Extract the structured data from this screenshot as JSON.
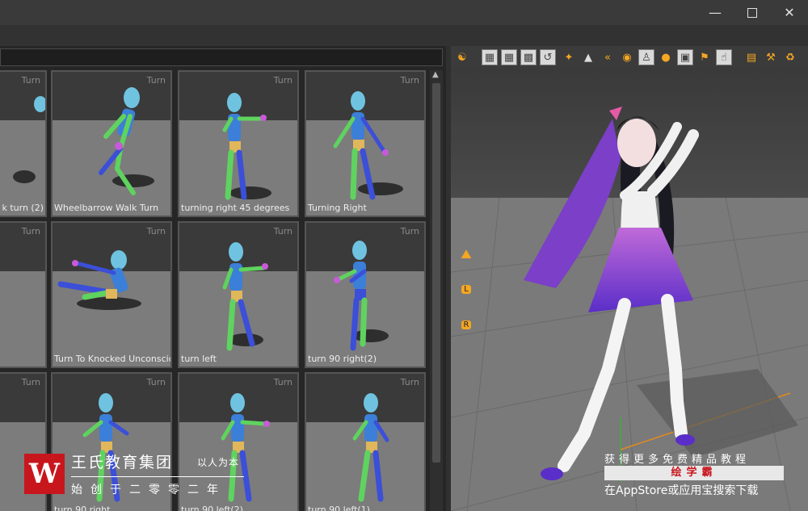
{
  "window": {
    "minimize_icon": "minimize-icon",
    "maximize_icon": "maximize-icon",
    "close_icon": "close-icon"
  },
  "library": {
    "cells": [
      {
        "badge": "Turn",
        "label": "k turn (2)"
      },
      {
        "badge": "Turn",
        "label": "Wheelbarrow Walk Turn"
      },
      {
        "badge": "Turn",
        "label": "turning right 45 degrees"
      },
      {
        "badge": "Turn",
        "label": "Turning Right"
      },
      {
        "badge": "Turn",
        "label": ""
      },
      {
        "badge": "Turn",
        "label": "Turn To Knocked Unconscious"
      },
      {
        "badge": "Turn",
        "label": "turn left"
      },
      {
        "badge": "Turn",
        "label": "turn 90 right(2)"
      },
      {
        "badge": "Turn",
        "label": ""
      },
      {
        "badge": "Turn",
        "label": "turn 90 right"
      },
      {
        "badge": "Turn",
        "label": "turn 90 left(2)"
      },
      {
        "badge": "Turn",
        "label": "turn 90 left(1)"
      }
    ]
  },
  "viewport": {
    "toolbar_icons": [
      "motion-icon",
      "grid-icon",
      "grid-fine-icon",
      "checker-icon",
      "camera-orbit-icon",
      "gizmo-icon",
      "mirror-icon",
      "rewind-icon",
      "floor-icon",
      "pose-icon",
      "sphere-icon",
      "screenshot-icon",
      "flag-icon",
      "skeleton-icon",
      "clapper-icon",
      "tools-icon",
      "recycle-icon"
    ],
    "side_icons": [
      "body-pose-icon",
      "left-hand-icon",
      "right-hand-icon"
    ],
    "left_hand_letter": "L",
    "right_hand_letter": "R"
  },
  "watermark": {
    "logo_letter": "W",
    "title": "王氏教育集团",
    "subtitle": "以人为本",
    "motto": "始创于二零零二年"
  },
  "promo": {
    "top": "获得更多免费精品教程",
    "brand": "绘学霸",
    "bottom": "在AppStore或应用宝搜索下载"
  },
  "colors": {
    "accent": "#f5a623",
    "brand_red": "#c8161d",
    "mannequin_head": "#6fc3e0",
    "mannequin_green": "#5fd35f",
    "mannequin_blue": "#3b4fd8",
    "mannequin_pelvis": "#e0b75a",
    "mannequin_hand": "#c85ad8"
  }
}
